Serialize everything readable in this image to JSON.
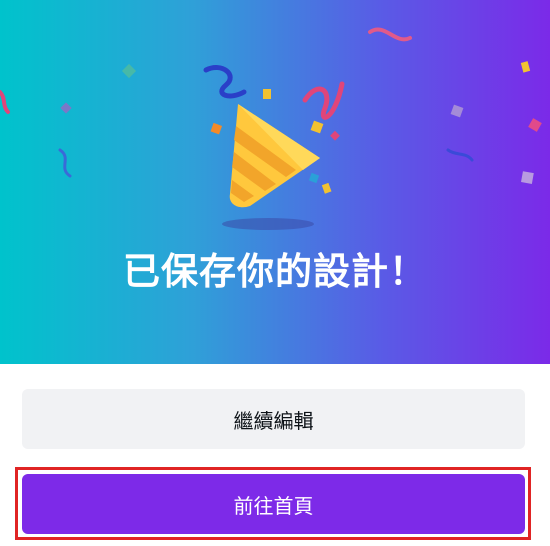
{
  "dialog": {
    "headline": "已保存你的設計！",
    "continue_label": "繼續編輯",
    "home_label": "前往首頁"
  },
  "colors": {
    "gradient_start": "#00c3cc",
    "gradient_end": "#7b2ae8",
    "primary_button": "#7d2ae8",
    "secondary_button": "#f1f2f4",
    "highlight_border": "#e02424"
  },
  "icons": {
    "hero": "party-popper-icon"
  }
}
